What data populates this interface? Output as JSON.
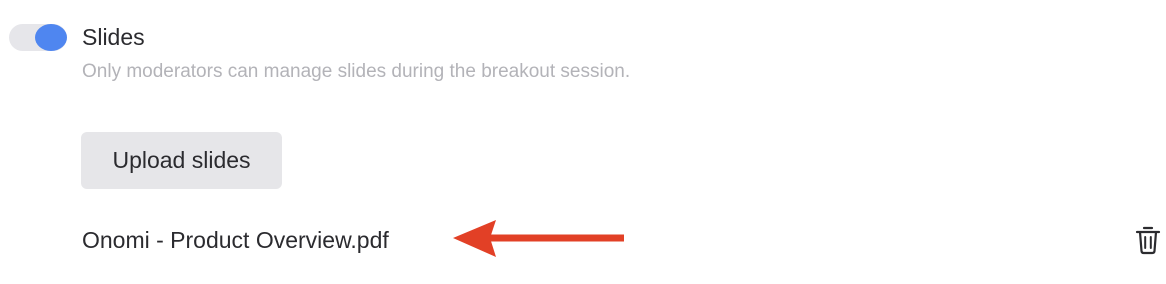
{
  "slides_setting": {
    "toggle_on": true,
    "label": "Slides",
    "description": "Only moderators can manage slides during the breakout session.",
    "toggle_color": "#4f86f0"
  },
  "upload": {
    "button_label": "Upload slides"
  },
  "files": [
    {
      "name": "Onomi - Product Overview.pdf",
      "action_icon": "trash-icon"
    }
  ],
  "annotation": {
    "arrow_color": "#e24026"
  }
}
